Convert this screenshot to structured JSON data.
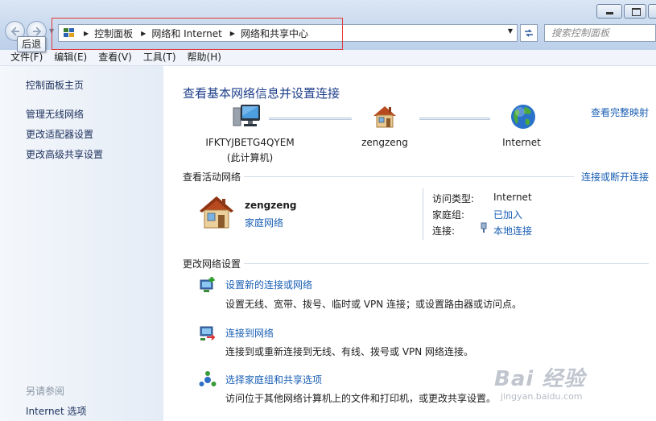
{
  "navigation": {
    "back_tooltip": "后退",
    "breadcrumb": [
      "控制面板",
      "网络和 Internet",
      "网络和共享中心"
    ],
    "search_placeholder": "搜索控制面板"
  },
  "menu": [
    "文件(F)",
    "编辑(E)",
    "查看(V)",
    "工具(T)",
    "帮助(H)"
  ],
  "sidebar": {
    "home": "控制面板主页",
    "links": [
      "管理无线网络",
      "更改适配器设置",
      "更改高级共享设置"
    ],
    "see_also_label": "另请参阅",
    "see_also_links": [
      "Internet 选项"
    ]
  },
  "main": {
    "title": "查看基本网络信息并设置连接",
    "view_full_map": "查看完整映射",
    "map_nodes": [
      {
        "label": "IFKTYJBETG4QYEM",
        "sublabel": "(此计算机)",
        "icon": "computer-icon"
      },
      {
        "label": "zengzeng",
        "icon": "home-network-icon"
      },
      {
        "label": "Internet",
        "icon": "globe-icon"
      }
    ],
    "active_networks": {
      "title": "查看活动网络",
      "connect_disconnect": "连接或断开连接",
      "network_name": "zengzeng",
      "network_type": "家庭网络",
      "access_type_label": "访问类型:",
      "access_type_value": "Internet",
      "homegroup_label": "家庭组:",
      "homegroup_value": "已加入",
      "connections_label": "连接:",
      "connections_value": "本地连接"
    },
    "change_settings": {
      "title": "更改网络设置",
      "tasks": [
        {
          "title": "设置新的连接或网络",
          "desc": "设置无线、宽带、拨号、临时或 VPN 连接；或设置路由器或访问点。"
        },
        {
          "title": "连接到网络",
          "desc": "连接到或重新连接到无线、有线、拨号或 VPN 网络连接。"
        },
        {
          "title": "选择家庭组和共享选项",
          "desc": "访问位于其他网络计算机上的文件和打印机，或更改共享设置。"
        }
      ]
    }
  },
  "watermark": {
    "brand": "Bai 经验",
    "url": "jingyan.baidu.com"
  },
  "colors": {
    "link": "#1a5fb4",
    "title": "#1e3f8b",
    "highlight_box": "#e23b3b"
  }
}
